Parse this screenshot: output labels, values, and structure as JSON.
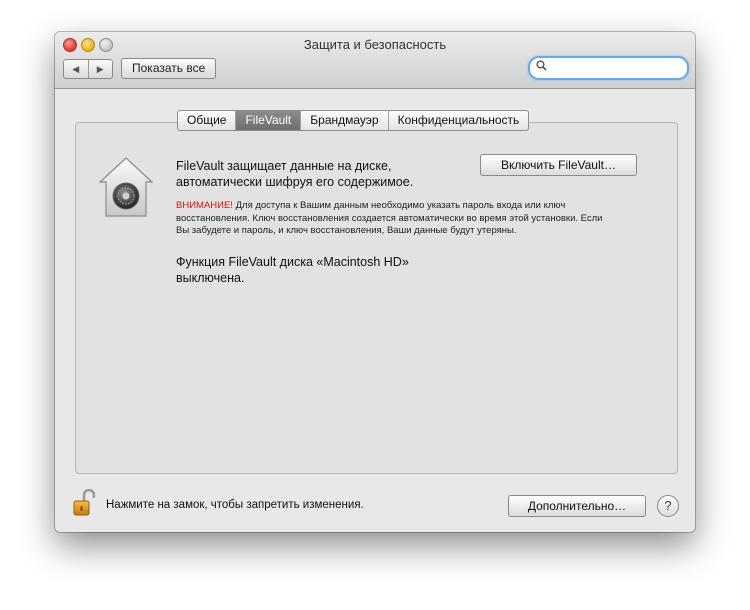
{
  "window": {
    "title": "Защита и безопасность",
    "show_all_label": "Показать все",
    "nav_back": "◀",
    "nav_forward": "▶",
    "search_placeholder": ""
  },
  "tabs": [
    {
      "label": "Общие",
      "active": false
    },
    {
      "label": "FileVault",
      "active": true
    },
    {
      "label": "Брандмауэр",
      "active": false
    },
    {
      "label": "Конфиденциальность",
      "active": false
    }
  ],
  "filevault": {
    "description_line1": "FileVault защищает данные на диске,",
    "description_line2": "автоматически шифруя его содержимое.",
    "enable_button": "Включить FileVault…",
    "warning_label": "ВНИМАНИЕ!",
    "warning_text": " Для доступа к Вашим данным необходимо указать пароль входа или ключ восстановления. Ключ восстановления создается автоматически во время этой установки. Если Вы забудете и пароль, и ключ восстановления, Ваши данные будут утеряны.",
    "status_line1": "Функция FileVault диска «Macintosh HD»",
    "status_line2": "выключена."
  },
  "footer": {
    "lock_text": "Нажмите на замок, чтобы запретить изменения.",
    "advanced_button": "Дополнительно…",
    "help_button": "?"
  },
  "icons": {
    "search": "magnifier-icon",
    "lock_house": "filevault-house-icon",
    "padlock": "open-padlock-icon"
  },
  "colors": {
    "warning": "#d01010",
    "search_focus": "#6aa7e8",
    "active_tab": "#7a7a7a"
  }
}
